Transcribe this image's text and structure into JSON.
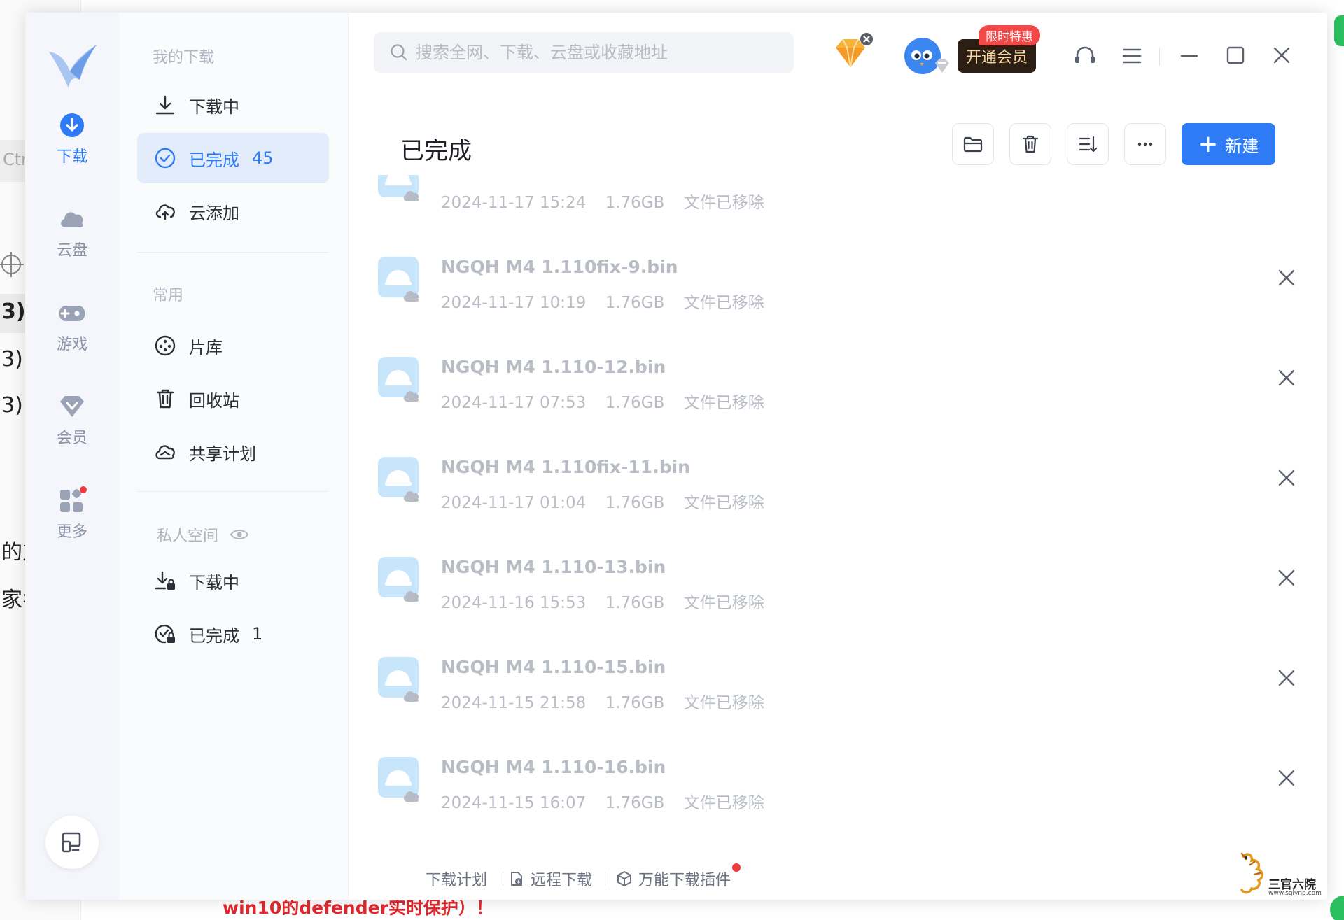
{
  "background": {
    "fragments": [
      "3) ",
      "3) ",
      "3) ",
      "的方",
      "家名"
    ],
    "ctrl_hint": "Ctr",
    "red_notice": "win10的defender实时保护）！"
  },
  "rail": {
    "items": [
      {
        "label": "下载",
        "icon": "download-icon",
        "active": true
      },
      {
        "label": "云盘",
        "icon": "cloud-icon",
        "active": false
      },
      {
        "label": "游戏",
        "icon": "gamepad-icon",
        "active": false
      },
      {
        "label": "会员",
        "icon": "diamond-icon",
        "active": false
      },
      {
        "label": "更多",
        "icon": "apps-icon",
        "active": false
      }
    ]
  },
  "nav": {
    "section_my": "我的下载",
    "downloading": "下载中",
    "completed": "已完成",
    "completed_count": "45",
    "cloud_add": "云添加",
    "section_common": "常用",
    "library": "片库",
    "recycle": "回收站",
    "share_plan": "共享计划",
    "section_private": "私人空间",
    "private_downloading": "下载中",
    "private_completed": "已完成",
    "private_completed_count": "1"
  },
  "topbar": {
    "search_placeholder": "搜索全网、下载、云盘或收藏地址",
    "vip_button": "开通会员",
    "vip_badge": "限时特惠"
  },
  "content": {
    "title": "已完成",
    "new_button": "新建"
  },
  "files": [
    {
      "name": "",
      "date": "2024-11-17 15:24",
      "size": "1.76GB",
      "status": "文件已移除"
    },
    {
      "name": "NGQH M4 1.110fix-9.bin",
      "date": "2024-11-17 10:19",
      "size": "1.76GB",
      "status": "文件已移除"
    },
    {
      "name": "NGQH M4 1.110-12.bin",
      "date": "2024-11-17 07:53",
      "size": "1.76GB",
      "status": "文件已移除"
    },
    {
      "name": "NGQH M4 1.110fix-11.bin",
      "date": "2024-11-17 01:04",
      "size": "1.76GB",
      "status": "文件已移除"
    },
    {
      "name": "NGQH M4 1.110-13.bin",
      "date": "2024-11-16 15:53",
      "size": "1.76GB",
      "status": "文件已移除"
    },
    {
      "name": "NGQH M4 1.110-15.bin",
      "date": "2024-11-15 21:58",
      "size": "1.76GB",
      "status": "文件已移除"
    },
    {
      "name": "NGQH M4 1.110-16.bin",
      "date": "2024-11-15 16:07",
      "size": "1.76GB",
      "status": "文件已移除"
    }
  ],
  "footer": {
    "plan": "下载计划",
    "remote": "远程下载",
    "plugin": "万能下载插件"
  },
  "watermark": {
    "text": "三官六院",
    "url": "www.sgiynp.com"
  },
  "colors": {
    "accent": "#2e7bf5",
    "selected_bg": "#e3ecfb",
    "badge_red": "#f24848",
    "vip_dark": "#2c1e12"
  }
}
